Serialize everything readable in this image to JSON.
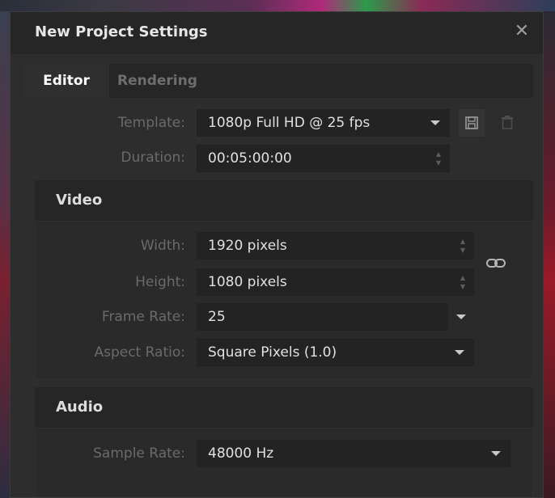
{
  "dialog": {
    "title": "New Project Settings"
  },
  "tabs": [
    {
      "label": "Editor",
      "active": true
    },
    {
      "label": "Rendering",
      "active": false
    }
  ],
  "template": {
    "label": "Template:",
    "value": "1080p Full HD @ 25 fps"
  },
  "duration": {
    "label": "Duration:",
    "value": "00:05:00:00"
  },
  "video": {
    "heading": "Video",
    "width": {
      "label": "Width:",
      "value": "1920 pixels"
    },
    "height": {
      "label": "Height:",
      "value": "1080 pixels"
    },
    "frame_rate": {
      "label": "Frame Rate:",
      "value": "25"
    },
    "aspect_ratio": {
      "label": "Aspect Ratio:",
      "value": "Square Pixels (1.0)"
    }
  },
  "audio": {
    "heading": "Audio",
    "sample_rate": {
      "label": "Sample Rate:",
      "value": "48000 Hz"
    }
  },
  "icons": {
    "close": "close-icon",
    "save": "save-icon",
    "delete": "trash-icon",
    "link": "link-icon"
  }
}
